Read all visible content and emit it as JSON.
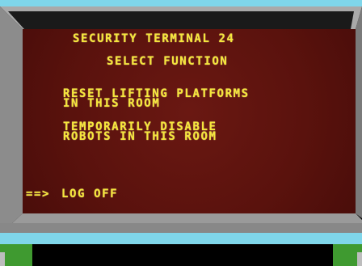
{
  "terminal": {
    "title": "SECURITY TERMINAL 24",
    "subtitle": "SELECT FUNCTION",
    "options": [
      {
        "line1": "RESET LIFTING PLATFORMS",
        "line2": "IN THIS ROOM"
      },
      {
        "line1": "TEMPORARILY DISABLE",
        "line2": "ROBOTS IN THIS ROOM"
      }
    ],
    "cursor": "==>",
    "logoff_label": "LOG OFF"
  },
  "colors": {
    "screen_bg": "#5e130f",
    "text": "#f5e63a",
    "bezel_gray": "#8f8f8f",
    "bezel_dark": "#5f5f5f",
    "frame_cyan": "#7fd6ea",
    "frame_green": "#3f9a30"
  }
}
